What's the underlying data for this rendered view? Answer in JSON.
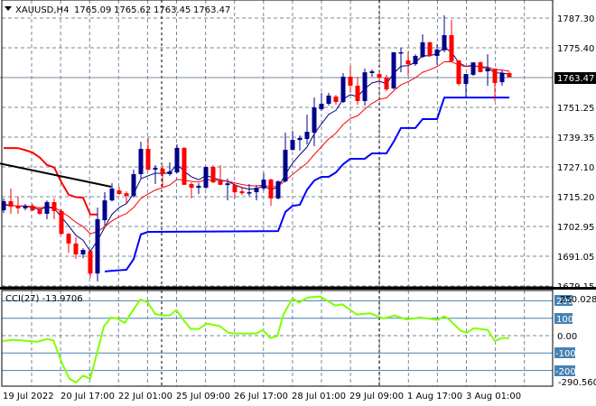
{
  "header": {
    "symbol": "XAUUSD,H4",
    "open": "1765.09",
    "high": "1765.62",
    "low": "1763.45",
    "close": "1763.47"
  },
  "price_axis": {
    "labels": [
      "1787.30",
      "1775.40",
      "1751.25",
      "1739.35",
      "1727.10",
      "1715.20",
      "1702.95",
      "1691.05",
      "1679.15"
    ],
    "current_price": "1763.47"
  },
  "cci_panel": {
    "title": "CCI(27) -13.9706",
    "max_label": "250.0282",
    "min_label": "-290.5605",
    "level_labels": [
      "200",
      "100",
      "-100",
      "-200"
    ],
    "zero_label": "0.00"
  },
  "time_axis": {
    "labels": [
      "19 Jul 2022",
      "20 Jul 17:00",
      "22 Jul 01:00",
      "25 Jul 09:00",
      "26 Jul 17:00",
      "28 Jul 01:00",
      "29 Jul 09:00",
      "1 Aug 17:00",
      "3 Aug 01:00"
    ]
  },
  "colors": {
    "bull": "#00008b",
    "bear": "#ff0000",
    "fast_ma": "#000080",
    "slow_ma": "#ff0000",
    "support": "#0000ff",
    "resistance": "#ff0000",
    "trendline": "#000000",
    "cci": "#7fff00",
    "cci_level": "#4682b4",
    "grid": "#778899"
  },
  "chart_data": {
    "type": "candlestick",
    "ylim": [
      1679.15,
      1787.3
    ],
    "ohlc": [
      [
        1709.7,
        1714.5,
        1708.6,
        1713.4
      ],
      [
        1713.4,
        1718.5,
        1708.3,
        1711.2
      ],
      [
        1711.3,
        1715.2,
        1708.3,
        1710.5
      ],
      [
        1710.5,
        1712.3,
        1709.7,
        1711.5
      ],
      [
        1711.5,
        1712.3,
        1709.4,
        1709.7
      ],
      [
        1710.1,
        1710.8,
        1707.9,
        1708.3
      ],
      [
        1708.3,
        1713.7,
        1706.1,
        1713.0
      ],
      [
        1713.0,
        1714.5,
        1706.1,
        1709.4
      ],
      [
        1709.4,
        1710.1,
        1699.9,
        1700.2
      ],
      [
        1700.2,
        1700.6,
        1692.6,
        1696.3
      ],
      [
        1696.3,
        1698.8,
        1690.1,
        1691.9
      ],
      [
        1691.9,
        1694.4,
        1690.4,
        1693.7
      ],
      [
        1693.3,
        1693.3,
        1682.4,
        1684.2
      ],
      [
        1684.2,
        1710.8,
        1681.0,
        1706.1
      ],
      [
        1705.7,
        1717.0,
        1703.5,
        1713.7
      ],
      [
        1713.7,
        1720.6,
        1713.3,
        1718.5
      ],
      [
        1717.7,
        1719.2,
        1715.9,
        1716.3
      ],
      [
        1716.6,
        1717.4,
        1712.6,
        1715.5
      ],
      [
        1715.5,
        1726.1,
        1714.8,
        1724.3
      ],
      [
        1724.3,
        1737.4,
        1722.5,
        1734.5
      ],
      [
        1734.5,
        1738.9,
        1725.7,
        1726.1
      ],
      [
        1726.1,
        1727.9,
        1720.3,
        1726.8
      ],
      [
        1726.5,
        1727.9,
        1719.2,
        1724.3
      ],
      [
        1724.3,
        1729.0,
        1723.6,
        1725.4
      ],
      [
        1725.0,
        1736.3,
        1724.7,
        1734.9
      ],
      [
        1734.9,
        1735.2,
        1719.9,
        1720.0
      ],
      [
        1720.3,
        1721.0,
        1714.5,
        1718.8
      ],
      [
        1718.8,
        1720.6,
        1716.3,
        1719.6
      ],
      [
        1718.8,
        1727.2,
        1718.4,
        1727.2
      ],
      [
        1727.2,
        1727.9,
        1720.6,
        1721.0
      ],
      [
        1721.4,
        1727.9,
        1719.9,
        1720.0
      ],
      [
        1719.9,
        1722.5,
        1713.7,
        1720.6
      ],
      [
        1719.9,
        1719.9,
        1714.5,
        1717.0
      ],
      [
        1717.4,
        1719.2,
        1715.9,
        1716.6
      ],
      [
        1716.6,
        1720.3,
        1715.5,
        1717.0
      ],
      [
        1717.0,
        1719.9,
        1713.7,
        1718.8
      ],
      [
        1718.5,
        1724.7,
        1717.7,
        1722.1
      ],
      [
        1722.1,
        1722.5,
        1711.5,
        1714.5
      ],
      [
        1714.5,
        1721.7,
        1714.1,
        1721.4
      ],
      [
        1721.4,
        1741.0,
        1721.0,
        1734.1
      ],
      [
        1734.1,
        1741.8,
        1733.8,
        1738.1
      ],
      [
        1738.1,
        1739.9,
        1733.8,
        1738.9
      ],
      [
        1738.5,
        1748.3,
        1736.3,
        1741.4
      ],
      [
        1741.0,
        1755.2,
        1735.6,
        1751.2
      ],
      [
        1750.5,
        1757.1,
        1749.8,
        1752.7
      ],
      [
        1752.7,
        1757.1,
        1752.0,
        1756.0
      ],
      [
        1755.6,
        1756.3,
        1752.3,
        1753.4
      ],
      [
        1753.4,
        1765.1,
        1753.0,
        1763.6
      ],
      [
        1763.6,
        1768.0,
        1757.1,
        1760.0
      ],
      [
        1760.0,
        1763.6,
        1752.3,
        1753.8
      ],
      [
        1753.8,
        1766.9,
        1752.0,
        1765.4
      ],
      [
        1765.1,
        1766.5,
        1763.6,
        1765.8
      ],
      [
        1764.7,
        1765.8,
        1760.7,
        1763.3
      ],
      [
        1763.3,
        1764.4,
        1757.8,
        1758.5
      ],
      [
        1758.9,
        1773.5,
        1758.5,
        1773.5
      ],
      [
        1773.1,
        1775.3,
        1765.4,
        1773.5
      ],
      [
        1770.2,
        1773.8,
        1764.0,
        1768.7
      ],
      [
        1768.7,
        1772.7,
        1768.0,
        1772.0
      ],
      [
        1771.6,
        1780.7,
        1771.3,
        1777.5
      ],
      [
        1777.5,
        1777.8,
        1771.6,
        1772.0
      ],
      [
        1772.0,
        1776.7,
        1768.4,
        1774.6
      ],
      [
        1774.3,
        1788.4,
        1773.5,
        1780.4
      ],
      [
        1780.4,
        1786.6,
        1769.8,
        1769.9
      ],
      [
        1770.2,
        1770.2,
        1760.0,
        1760.7
      ],
      [
        1760.7,
        1764.7,
        1755.2,
        1764.7
      ],
      [
        1764.4,
        1769.4,
        1764.0,
        1769.4
      ],
      [
        1769.4,
        1769.8,
        1765.4,
        1765.5
      ],
      [
        1765.8,
        1772.7,
        1760.0,
        1766.9
      ],
      [
        1766.9,
        1766.9,
        1753.8,
        1761.1
      ],
      [
        1761.4,
        1766.2,
        1760.0,
        1765.1
      ],
      [
        1765.09,
        1765.62,
        1763.45,
        1763.47
      ]
    ],
    "resistance_line": [
      [
        0,
        1734.8
      ],
      [
        1,
        1734.8
      ],
      [
        2,
        1734.8
      ],
      [
        3,
        1734.0
      ],
      [
        4,
        1733.0
      ],
      [
        5,
        1731.0
      ],
      [
        6,
        1728.0
      ],
      [
        7,
        1727.0
      ],
      [
        8,
        1721.0
      ],
      [
        9,
        1716.0
      ],
      [
        10,
        1715.0
      ],
      [
        11,
        1714.8
      ],
      [
        12,
        1708.0
      ],
      [
        13,
        1708.0
      ]
    ],
    "support_line": [
      [
        14,
        1685.0
      ],
      [
        15,
        1685.3
      ],
      [
        16,
        1685.5
      ],
      [
        17,
        1685.7
      ],
      [
        18,
        1690.0
      ],
      [
        19,
        1700.0
      ],
      [
        20,
        1701.0
      ],
      [
        38,
        1701.3
      ],
      [
        39,
        1709.0
      ],
      [
        40,
        1711.5
      ],
      [
        41,
        1711.9
      ],
      [
        42,
        1718.0
      ],
      [
        43,
        1721.7
      ],
      [
        44,
        1723.2
      ],
      [
        45,
        1723.2
      ],
      [
        46,
        1725.0
      ],
      [
        47,
        1728.3
      ],
      [
        48,
        1730.5
      ],
      [
        50,
        1730.5
      ],
      [
        51,
        1732.7
      ],
      [
        53,
        1732.7
      ],
      [
        54,
        1737.4
      ],
      [
        55,
        1742.9
      ],
      [
        57,
        1742.9
      ],
      [
        58,
        1746.5
      ],
      [
        60,
        1746.5
      ],
      [
        61,
        1755.2
      ],
      [
        70,
        1755.2
      ]
    ],
    "trendline": [
      [
        -0.5,
        1728.6
      ],
      [
        14.9,
        1719.2
      ]
    ],
    "fast_ma_period": 5,
    "slow_ma_period": 12,
    "cci": {
      "ylim": [
        -290.5605,
        250.0282
      ],
      "levels": [
        200,
        100,
        0,
        -100,
        -200
      ],
      "points": [
        [
          -0.1,
          -31
        ],
        [
          1.4,
          -24
        ],
        [
          4.75,
          -35
        ],
        [
          6,
          -19
        ],
        [
          6.9,
          -28
        ],
        [
          8.1,
          -161
        ],
        [
          9.1,
          -247
        ],
        [
          10,
          -269
        ],
        [
          11,
          -230
        ],
        [
          12,
          -247
        ],
        [
          13.9,
          55
        ],
        [
          14.9,
          104
        ],
        [
          15.75,
          98
        ],
        [
          16.75,
          73
        ],
        [
          18.9,
          207
        ],
        [
          19.9,
          193
        ],
        [
          21,
          124
        ],
        [
          22,
          116
        ],
        [
          23,
          116
        ],
        [
          23.9,
          147
        ],
        [
          24.9,
          90
        ],
        [
          25.9,
          38
        ],
        [
          27,
          38
        ],
        [
          28.1,
          69
        ],
        [
          29.9,
          55
        ],
        [
          31.1,
          17
        ],
        [
          32.1,
          12
        ],
        [
          35,
          12
        ],
        [
          35.9,
          33
        ],
        [
          36.9,
          -14
        ],
        [
          37.9,
          -2
        ],
        [
          38.75,
          124
        ],
        [
          40,
          214
        ],
        [
          40.9,
          190
        ],
        [
          42.1,
          219
        ],
        [
          43.75,
          225
        ],
        [
          44.75,
          202
        ],
        [
          45.9,
          173
        ],
        [
          46.9,
          180
        ],
        [
          48.9,
          121
        ],
        [
          50.75,
          128
        ],
        [
          52.6,
          98
        ],
        [
          54.1,
          116
        ],
        [
          55.75,
          93
        ],
        [
          57.75,
          104
        ],
        [
          60.1,
          90
        ],
        [
          61,
          111
        ],
        [
          61.75,
          90
        ],
        [
          63.25,
          29
        ],
        [
          64.1,
          16
        ],
        [
          65.1,
          43
        ],
        [
          67,
          33
        ],
        [
          68,
          -31
        ],
        [
          69,
          -14
        ],
        [
          70,
          -14
        ]
      ]
    }
  }
}
